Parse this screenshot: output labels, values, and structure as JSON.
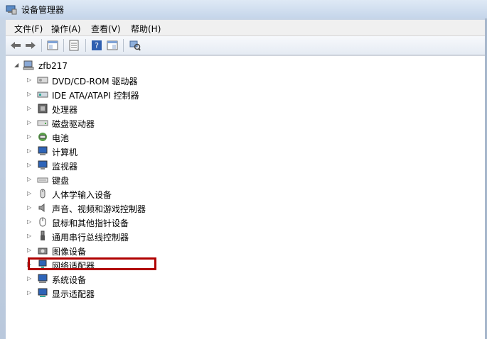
{
  "window": {
    "title": "设备管理器"
  },
  "menu": [
    "文件(F)",
    "操作(A)",
    "查看(V)",
    "帮助(H)"
  ],
  "toolbar": {
    "icons": [
      "back-arrow-icon",
      "forward-arrow-icon",
      "show-hide-tree-icon",
      "properties-icon",
      "help-icon",
      "view-icon",
      "scan-hardware-icon"
    ]
  },
  "tree": {
    "root": "zfb217",
    "items": [
      {
        "label": "DVD/CD-ROM 驱动器",
        "icon": "dvd-drive-icon"
      },
      {
        "label": "IDE ATA/ATAPI 控制器",
        "icon": "ide-controller-icon"
      },
      {
        "label": "处理器",
        "icon": "processor-icon"
      },
      {
        "label": "磁盘驱动器",
        "icon": "disk-drive-icon"
      },
      {
        "label": "电池",
        "icon": "battery-icon"
      },
      {
        "label": "计算机",
        "icon": "computer-icon"
      },
      {
        "label": "监视器",
        "icon": "monitor-icon"
      },
      {
        "label": "键盘",
        "icon": "keyboard-icon"
      },
      {
        "label": "人体学输入设备",
        "icon": "hid-icon"
      },
      {
        "label": "声音、视频和游戏控制器",
        "icon": "sound-icon"
      },
      {
        "label": "鼠标和其他指针设备",
        "icon": "mouse-icon"
      },
      {
        "label": "通用串行总线控制器",
        "icon": "usb-icon"
      },
      {
        "label": "图像设备",
        "icon": "imaging-icon"
      },
      {
        "label": "网络适配器",
        "icon": "network-adapter-icon"
      },
      {
        "label": "系统设备",
        "icon": "system-device-icon"
      },
      {
        "label": "显示适配器",
        "icon": "display-adapter-icon"
      }
    ]
  }
}
